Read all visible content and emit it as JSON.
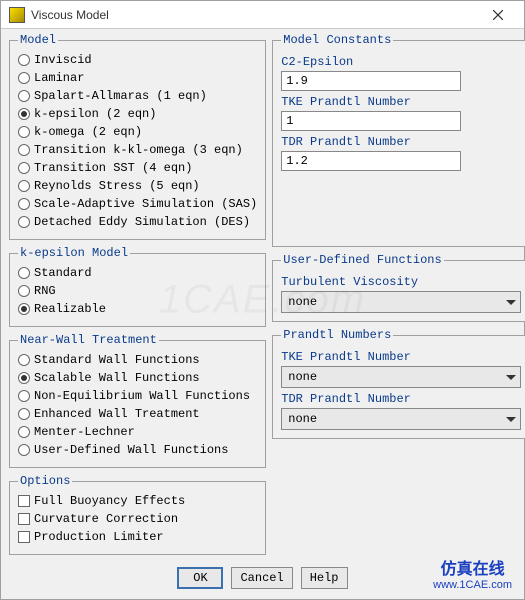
{
  "window": {
    "title": "Viscous Model"
  },
  "model": {
    "legend": "Model",
    "options": [
      {
        "label": "Inviscid",
        "selected": false
      },
      {
        "label": "Laminar",
        "selected": false
      },
      {
        "label": "Spalart-Allmaras (1 eqn)",
        "selected": false
      },
      {
        "label": "k-epsilon (2 eqn)",
        "selected": true
      },
      {
        "label": "k-omega (2 eqn)",
        "selected": false
      },
      {
        "label": "Transition k-kl-omega (3 eqn)",
        "selected": false
      },
      {
        "label": "Transition SST (4 eqn)",
        "selected": false
      },
      {
        "label": "Reynolds Stress (5 eqn)",
        "selected": false
      },
      {
        "label": "Scale-Adaptive Simulation (SAS)",
        "selected": false
      },
      {
        "label": "Detached Eddy Simulation (DES)",
        "selected": false
      }
    ]
  },
  "keps": {
    "legend": "k-epsilon Model",
    "options": [
      {
        "label": "Standard",
        "selected": false
      },
      {
        "label": "RNG",
        "selected": false
      },
      {
        "label": "Realizable",
        "selected": true
      }
    ]
  },
  "nwt": {
    "legend": "Near-Wall Treatment",
    "options": [
      {
        "label": "Standard Wall Functions",
        "selected": false
      },
      {
        "label": "Scalable Wall Functions",
        "selected": true
      },
      {
        "label": "Non-Equilibrium Wall Functions",
        "selected": false
      },
      {
        "label": "Enhanced Wall Treatment",
        "selected": false
      },
      {
        "label": "Menter-Lechner",
        "selected": false
      },
      {
        "label": "User-Defined Wall Functions",
        "selected": false
      }
    ]
  },
  "options": {
    "legend": "Options",
    "items": [
      {
        "label": "Full Buoyancy Effects",
        "checked": false
      },
      {
        "label": "Curvature Correction",
        "checked": false
      },
      {
        "label": "Production Limiter",
        "checked": false
      }
    ]
  },
  "constants": {
    "legend": "Model Constants",
    "c2_label": "C2-Epsilon",
    "c2_value": "1.9",
    "tke_label": "TKE Prandtl Number",
    "tke_value": "1",
    "tdr_label": "TDR Prandtl Number",
    "tdr_value": "1.2"
  },
  "udf": {
    "legend": "User-Defined Functions",
    "turb_visc_label": "Turbulent Viscosity",
    "turb_visc_value": "none"
  },
  "pn": {
    "legend": "Prandtl Numbers",
    "tke_label": "TKE Prandtl Number",
    "tke_value": "none",
    "tdr_label": "TDR Prandtl Number",
    "tdr_value": "none"
  },
  "buttons": {
    "ok": "OK",
    "cancel": "Cancel",
    "help": "Help"
  },
  "branding": {
    "cn": "仿真在线",
    "url": "www.1CAE.com"
  },
  "watermark": "1CAE.com"
}
